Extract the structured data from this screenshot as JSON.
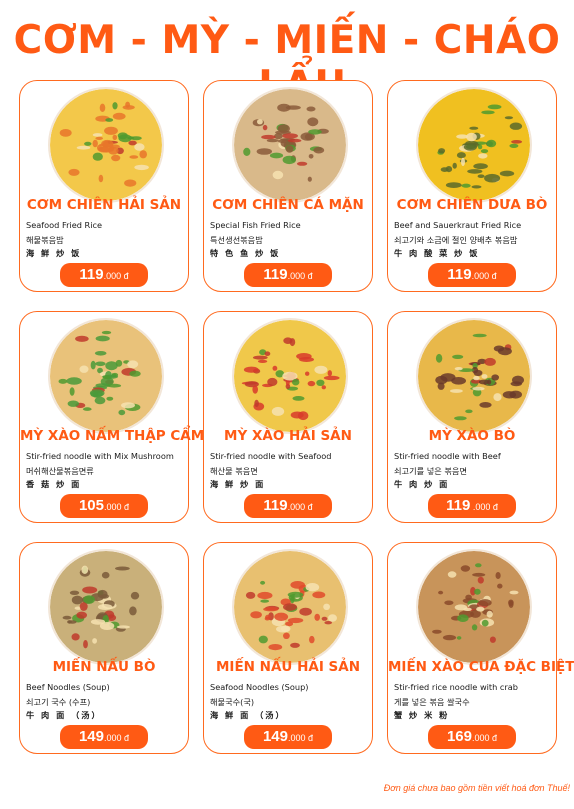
{
  "title": "CƠM - MỲ - MIẾN - CHÁO - LẨU",
  "items": [
    {
      "name": "CƠM CHIÊN HẢI SẢN",
      "en": "Seafood Fried Rice",
      "ko": "해물볶음밥",
      "zh": "海 鲜 炒 饭",
      "price_main": "119",
      "price_unit": ".000 đ",
      "plate": "#f3c84a",
      "accent": "#e8752a"
    },
    {
      "name": "CƠM CHIÊN CÁ MẶN",
      "en": "Special Fish Fried Rice",
      "ko": "특선생선볶음밥",
      "zh": "特 色 鱼 炒 饭",
      "price_main": "119",
      "price_unit": ".000 đ",
      "plate": "#d9b98a",
      "accent": "#8a5a3a"
    },
    {
      "name": "CƠM CHIÊN DƯA BÒ",
      "en": "Beef and Sauerkraut Fried Rice",
      "ko": "쇠고기와 소금에 절인 양배추 볶음밥",
      "zh": "牛 肉 酸 菜 炒 饭",
      "price_main": "119",
      "price_unit": ".000 đ",
      "plate": "#f0c020",
      "accent": "#5a6a2a"
    },
    {
      "name": "MỲ XÀO NẤM THẬP CẨM",
      "en": "Stir-fried noodle with Mix Mushroom",
      "ko": "머쉬해산물볶음면류",
      "zh": "香 菇 炒 面",
      "price_main": "105",
      "price_unit": ".000 đ",
      "plate": "#e9c27a",
      "accent": "#4a9a3a"
    },
    {
      "name": "MỲ XÀO HẢI SẢN",
      "en": "Stir-fried noodle with Seafood",
      "ko": "해산물 볶음면",
      "zh": "海 鲜 炒 面",
      "price_main": "119",
      "price_unit": ".000 đ",
      "plate": "#f0c84a",
      "accent": "#d83a2a"
    },
    {
      "name": "MỲ XÀO BÒ",
      "en": "Stir-fried noodle with Beef",
      "ko": "쇠고기를 넣은 볶음면",
      "zh": "牛 肉 炒 面",
      "price_main": "119",
      "price_unit": " .000 đ",
      "plate": "#e8b84a",
      "accent": "#6a3a2a"
    },
    {
      "name": "MIẾN NẤU BÒ",
      "en": "Beef Noodles (Soup)",
      "ko": "쇠고기 국수 (수프)",
      "zh": "牛 肉 面 （汤）",
      "price_main": "149",
      "price_unit": ".000 đ",
      "plate": "#c9b07a",
      "accent": "#7a5a3a"
    },
    {
      "name": "MIẾN NẤU HẢI SẢN",
      "en": "Seafood Noodles (Soup)",
      "ko": "해물국수(국)",
      "zh": "海 鲜 面 （汤）",
      "price_main": "149",
      "price_unit": ".000 đ",
      "plate": "#e8c070",
      "accent": "#e04a2a"
    },
    {
      "name": "MIẾN XÀO CUA ĐẶC BIỆT",
      "en": "Stir-fried rice noodle with crab",
      "ko": "게를 넣은 볶음 쌀국수",
      "zh": "蟹 炒 米 粉",
      "price_main": "169",
      "price_unit": ".000 đ",
      "plate": "#c8945a",
      "accent": "#8a4a2a"
    }
  ],
  "footer": "Đơn giá chưa bao gồm tiền viết hoá đơn Thuế!"
}
